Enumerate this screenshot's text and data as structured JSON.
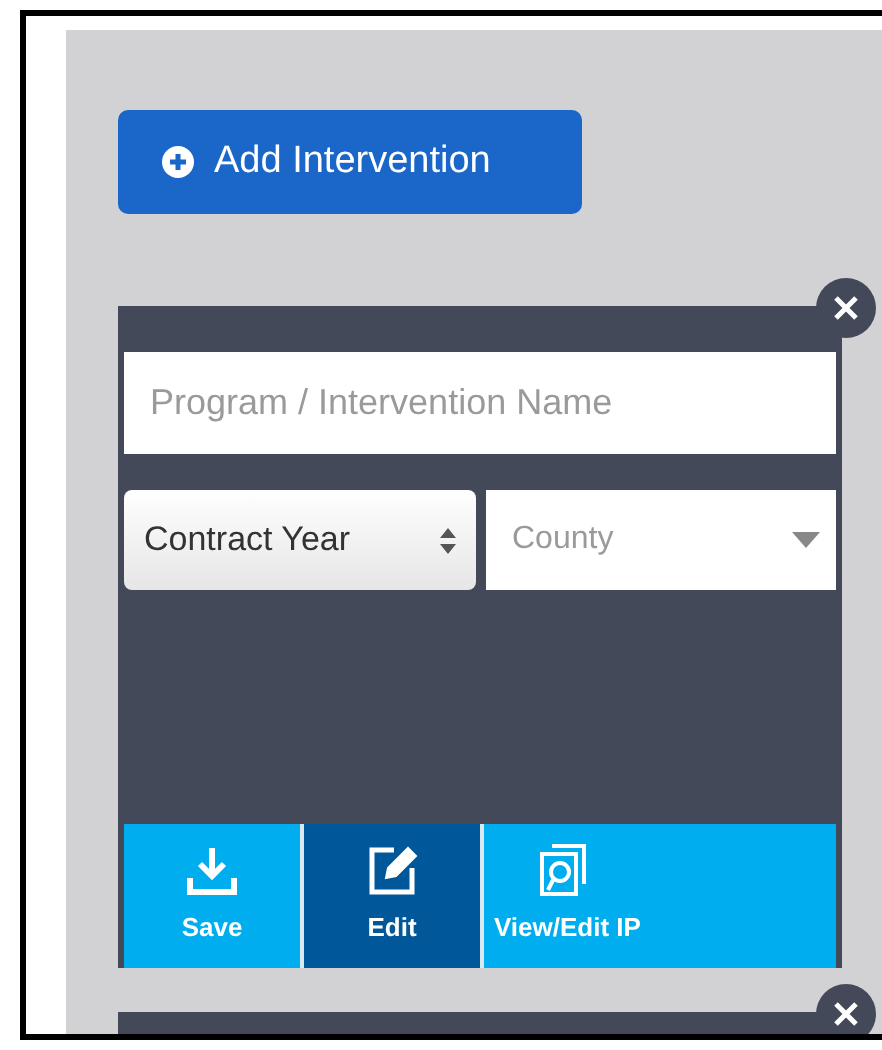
{
  "add_button": {
    "label": "Add Intervention"
  },
  "cards": [
    {
      "name_field": {
        "placeholder": "Program / Intervention Name"
      },
      "contract_year": {
        "value": "Contract Year"
      },
      "county": {
        "placeholder": "County"
      },
      "actions": [
        {
          "kind": "save",
          "label": "Save",
          "selected": false
        },
        {
          "kind": "edit",
          "label": "Edit",
          "selected": true
        },
        {
          "kind": "view",
          "label": "View/Edit IP",
          "selected": false
        }
      ]
    }
  ]
}
